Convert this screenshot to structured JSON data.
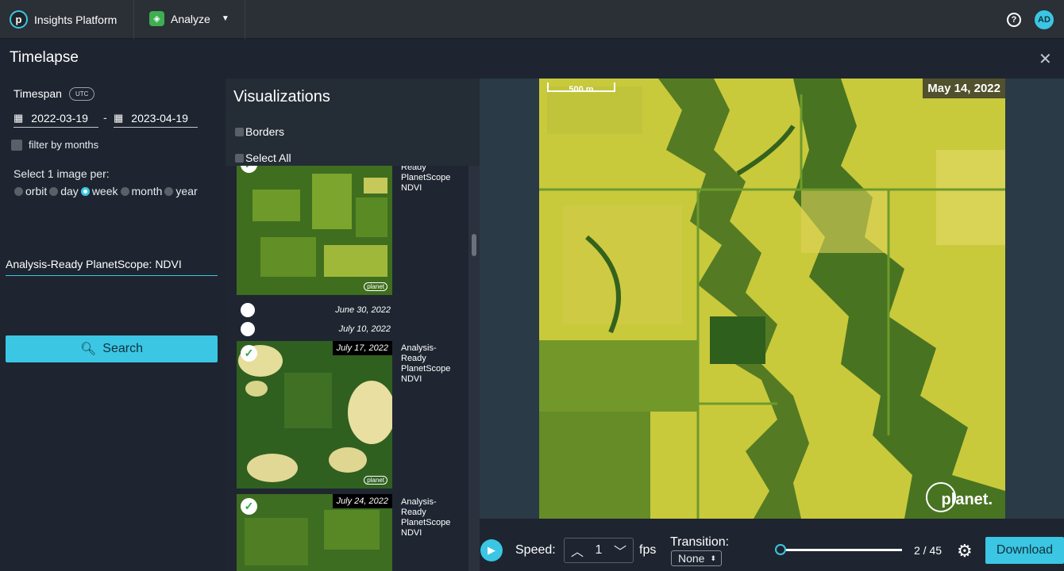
{
  "nav": {
    "brand": "Insights Platform",
    "module": "Analyze",
    "avatar": "AD",
    "help": "?"
  },
  "header": {
    "title": "Timelapse",
    "close": "✕"
  },
  "filters": {
    "timespan_label": "Timespan",
    "tz_badge": "UTC",
    "start_date": "2022-03-19",
    "end_date": "2023-04-19",
    "date_separator": "-",
    "filter_by_months": "filter by months",
    "per_label": "Select 1 image per:",
    "periods": [
      "orbit",
      "day",
      "week",
      "month",
      "year"
    ],
    "selected_period": "week",
    "source": "Analysis-Ready PlanetScope: NDVI",
    "search_label": "Search"
  },
  "visualizations": {
    "title": "Visualizations",
    "borders": "Borders",
    "select_all": "Select All",
    "meta_line1": "Analysis-",
    "meta_line2": "Ready",
    "meta_line3": "PlanetScope",
    "meta_line4": "NDVI",
    "items": [
      {
        "date": "",
        "selected": true
      },
      {
        "date": "June 30, 2022",
        "selected": false
      },
      {
        "date": "July 10, 2022",
        "selected": false
      },
      {
        "date": "July 17, 2022",
        "selected": true
      },
      {
        "date": "July 24, 2022",
        "selected": true
      }
    ],
    "thumb_tag": "planet"
  },
  "map": {
    "scale": "500 m",
    "date": "May 14, 2022",
    "watermark": "planet."
  },
  "controls": {
    "speed_label": "Speed:",
    "speed_value": "1",
    "fps": "fps",
    "transition_label": "Transition:",
    "transition_value": "None",
    "frame_current": 2,
    "frame_total": 45,
    "frames_text": "2 / 45",
    "download": "Download"
  },
  "colors": {
    "accent": "#3bc6e4",
    "ndvi_high": "#4e7b22",
    "ndvi_low": "#c7c83a"
  }
}
